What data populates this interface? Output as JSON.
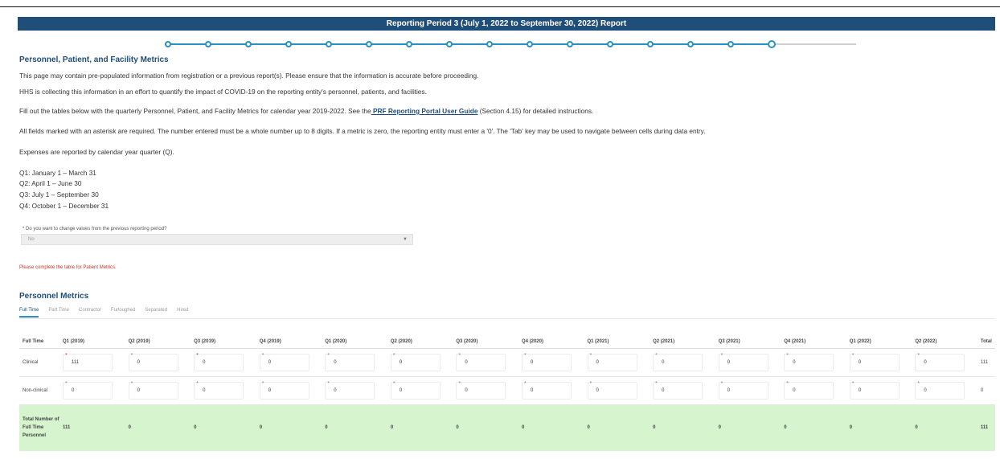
{
  "banner": {
    "title": "Reporting Period 3 (July 1, 2022 to September 30, 2022) Report"
  },
  "stepper": {
    "steps_total": 16,
    "completed": 15,
    "current_index": 15
  },
  "section_title": "Personnel, Patient, and Facility Metrics",
  "intro": {
    "p1": "This page may contain pre-populated information from registration or a previous report(s). Please ensure that the information is accurate before proceeding.",
    "p2": "HHS is collecting this information in an effort to quantify the impact of COVID-19 on the reporting entity's personnel, patients, and facilities.",
    "p3_before": "Fill out the tables below with the quarterly Personnel, Patient, and Facility Metrics for calendar year 2019-2022. See the",
    "p3_link": " PRF Reporting Portal User Guide",
    "p3_after": " (Section 4.15) for detailed instructions.",
    "p4": "All fields marked with an asterisk are required. The number entered must be a whole number up to 8 digits. If a metric is zero, the reporting entity must enter a '0'. The 'Tab' key may be used to navigate between cells during data entry.",
    "p5": "Expenses are reported by calendar year quarter (Q).",
    "quarters": [
      "Q1: January 1 – March 31",
      "Q2: April 1 – June 30",
      "Q3: July 1 – September 30",
      "Q4: October 1 – December 31"
    ]
  },
  "change_question": {
    "label": "* Do you want to change values from the previous reporting period?",
    "value": "No"
  },
  "error_text": "Please complete the table for Patient Metrics.",
  "personnel": {
    "title": "Personnel Metrics",
    "tabs": [
      "Full Time",
      "Part Time",
      "Contractor",
      "Furloughed",
      "Separated",
      "Hired"
    ],
    "active_tab": "Full Time",
    "columns": [
      "Full Time",
      "Q1 (2019)",
      "Q2 (2019)",
      "Q3 (2019)",
      "Q4 (2019)",
      "Q1 (2020)",
      "Q2 (2020)",
      "Q3 (2020)",
      "Q4 (2020)",
      "Q1 (2021)",
      "Q2 (2021)",
      "Q3 (2021)",
      "Q4 (2021)",
      "Q1 (2022)",
      "Q2 (2022)",
      "Total"
    ],
    "rows": [
      {
        "label": "Clinical",
        "values": [
          "111",
          "0",
          "0",
          "0",
          "0",
          "0",
          "0",
          "0",
          "0",
          "0",
          "0",
          "0",
          "0",
          "0"
        ],
        "total": "111"
      },
      {
        "label": "Non-clinical",
        "values": [
          "0",
          "0",
          "0",
          "0",
          "0",
          "0",
          "0",
          "0",
          "0",
          "0",
          "0",
          "0",
          "0",
          "0"
        ],
        "total": "0"
      }
    ],
    "total_row": {
      "label": "Total Number of Full Time Personnel",
      "values": [
        "111",
        "0",
        "0",
        "0",
        "0",
        "0",
        "0",
        "0",
        "0",
        "0",
        "0",
        "0",
        "0",
        "0"
      ],
      "total": "111"
    }
  }
}
